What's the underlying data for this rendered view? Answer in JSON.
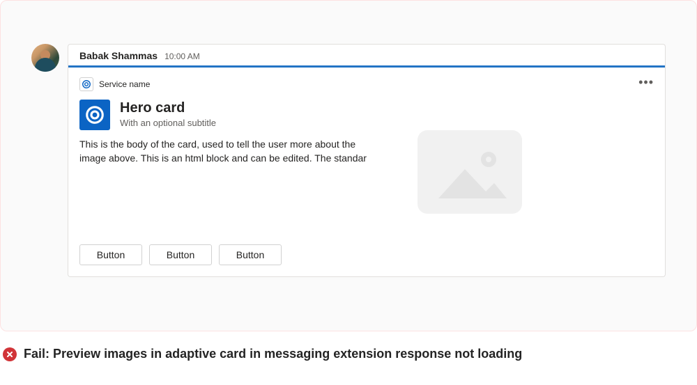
{
  "message": {
    "sender": "Babak Shammas",
    "timestamp": "10:00 AM"
  },
  "card": {
    "service_name": "Service name",
    "title": "Hero card",
    "subtitle": "With an optional subtitle",
    "body": "This is the body of the card, used to tell the user more about the image above. This is an html block and can be edited. The standar",
    "buttons": [
      "Button",
      "Button",
      "Button"
    ]
  },
  "caption": {
    "prefix": "Fail:",
    "text": "Preview images in adaptive card in messaging extension response not loading"
  }
}
